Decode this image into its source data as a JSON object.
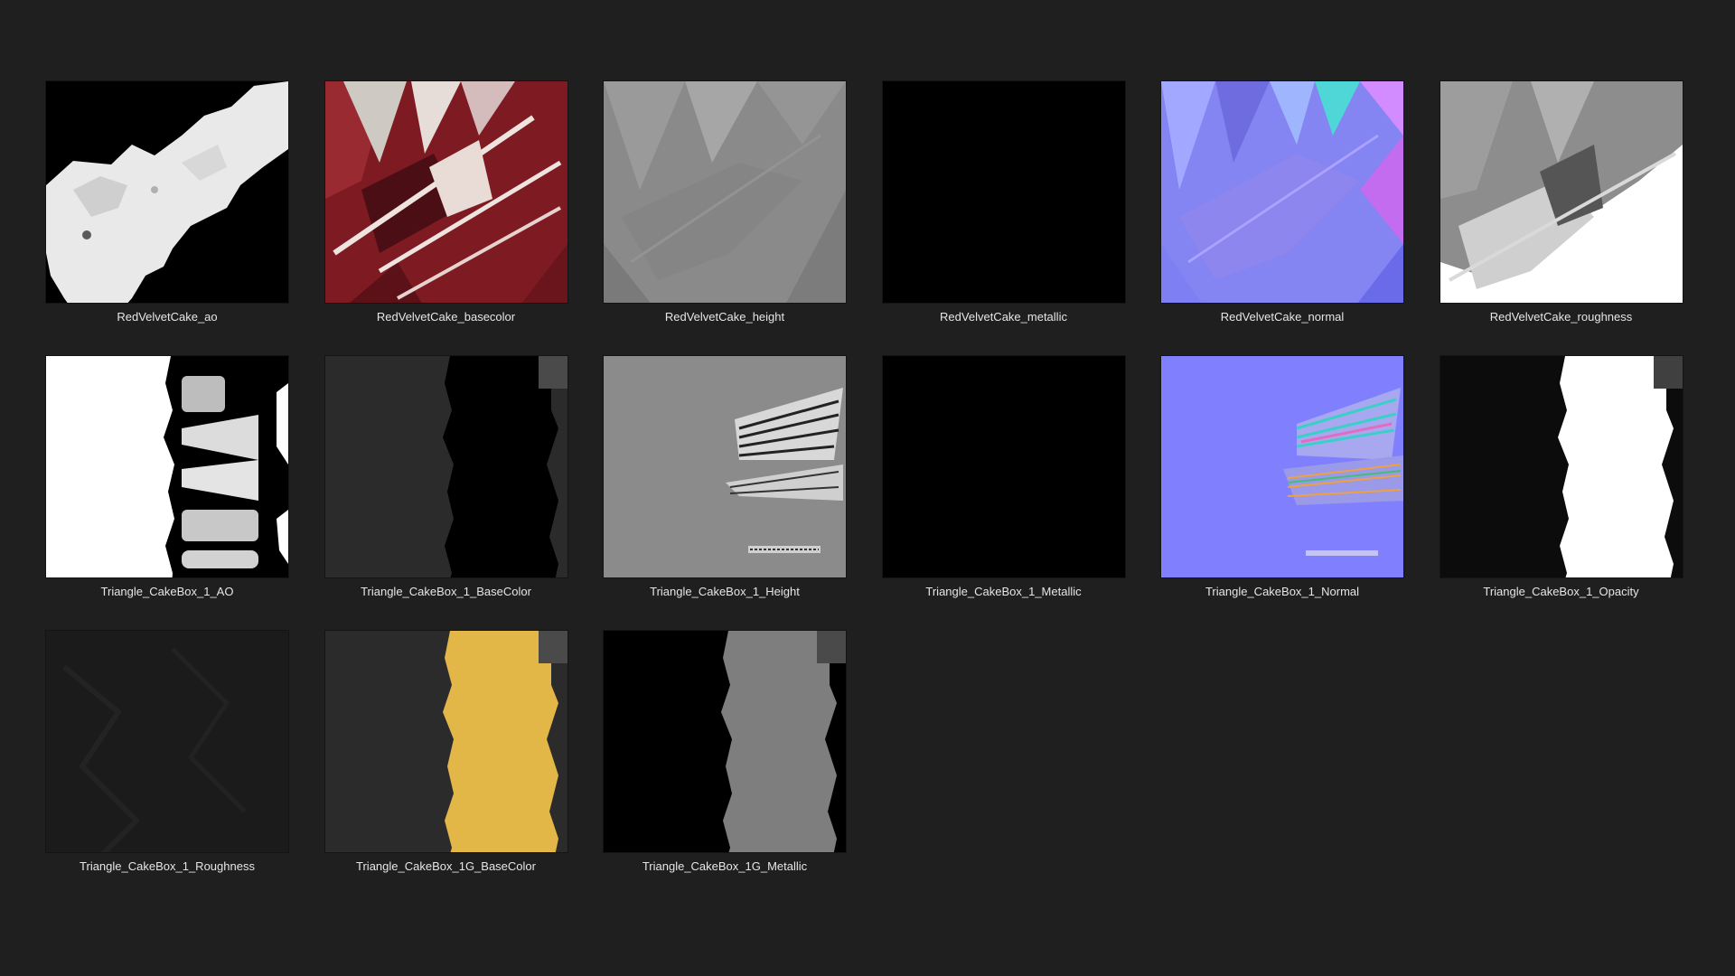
{
  "files": [
    {
      "name": "RedVelvetCake_ao",
      "icon": "ao-map-thumbnail"
    },
    {
      "name": "RedVelvetCake_basecolor",
      "icon": "basecolor-map-thumbnail"
    },
    {
      "name": "RedVelvetCake_height",
      "icon": "height-map-thumbnail"
    },
    {
      "name": "RedVelvetCake_metallic",
      "icon": "metallic-map-thumbnail"
    },
    {
      "name": "RedVelvetCake_normal",
      "icon": "normal-map-thumbnail"
    },
    {
      "name": "RedVelvetCake_roughness",
      "icon": "roughness-map-thumbnail"
    },
    {
      "name": "Triangle_CakeBox_1_AO",
      "icon": "ao-map-thumbnail"
    },
    {
      "name": "Triangle_CakeBox_1_BaseColor",
      "icon": "basecolor-map-thumbnail"
    },
    {
      "name": "Triangle_CakeBox_1_Height",
      "icon": "height-map-thumbnail"
    },
    {
      "name": "Triangle_CakeBox_1_Metallic",
      "icon": "metallic-map-thumbnail"
    },
    {
      "name": "Triangle_CakeBox_1_Normal",
      "icon": "normal-map-thumbnail"
    },
    {
      "name": "Triangle_CakeBox_1_Opacity",
      "icon": "opacity-map-thumbnail"
    },
    {
      "name": "Triangle_CakeBox_1_Roughness",
      "icon": "roughness-map-thumbnail"
    },
    {
      "name": "Triangle_CakeBox_1G_BaseColor",
      "icon": "basecolor-map-thumbnail"
    },
    {
      "name": "Triangle_CakeBox_1G_Metallic",
      "icon": "metallic-map-thumbnail"
    }
  ],
  "colors": {
    "background": "#1f1f1f",
    "label": "#e6e6e6",
    "red_velvet": "#8c1d24",
    "normal_blue": "#8080ff",
    "cakebox_yellow": "#e2b748"
  }
}
